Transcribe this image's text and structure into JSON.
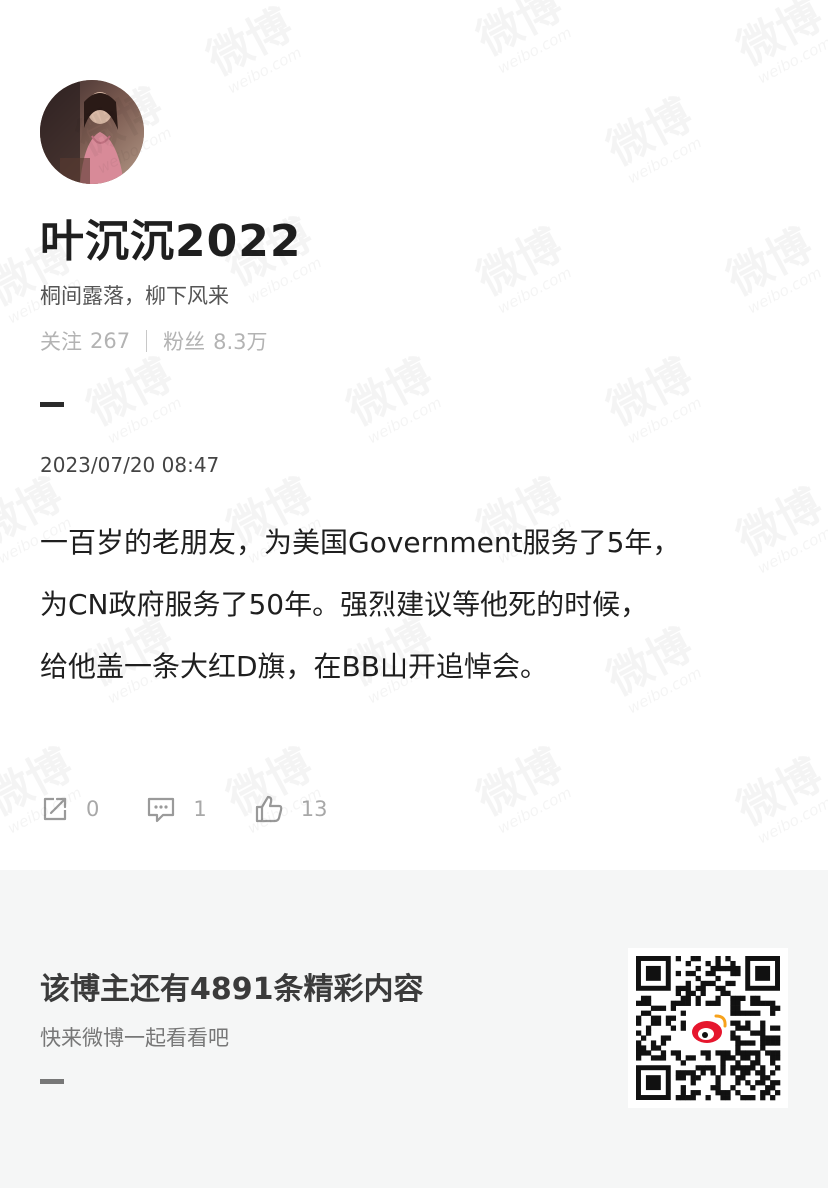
{
  "profile": {
    "nickname": "叶沉沉2022",
    "bio": "桐间露落，柳下风来",
    "following_label": "关注",
    "following_count": "267",
    "followers_label": "粉丝",
    "followers_count": "8.3万"
  },
  "post": {
    "timestamp": "2023/07/20 08:47",
    "lines": [
      "一百岁的老朋友，为美国Government服务了5年，",
      "为CN政府服务了50年。强烈建议等他死的时候，",
      "给他盖一条大红D旗，在BB山开追悼会。"
    ]
  },
  "actions": {
    "repost_count": "0",
    "comment_count": "1",
    "like_count": "13"
  },
  "footer": {
    "title": "该博主还有4891条精彩内容",
    "subtitle": "快来微博一起看看吧"
  },
  "watermark": {
    "cn": "微博",
    "en": "weibo.com"
  },
  "colors": {
    "text_primary": "#1f1f1f",
    "text_muted": "#b3b3b3",
    "footer_bg": "#f5f6f6",
    "weibo_red": "#e6162d"
  },
  "icons": [
    "repost-icon",
    "comment-icon",
    "like-icon",
    "qr-code",
    "weibo-logo-icon"
  ]
}
